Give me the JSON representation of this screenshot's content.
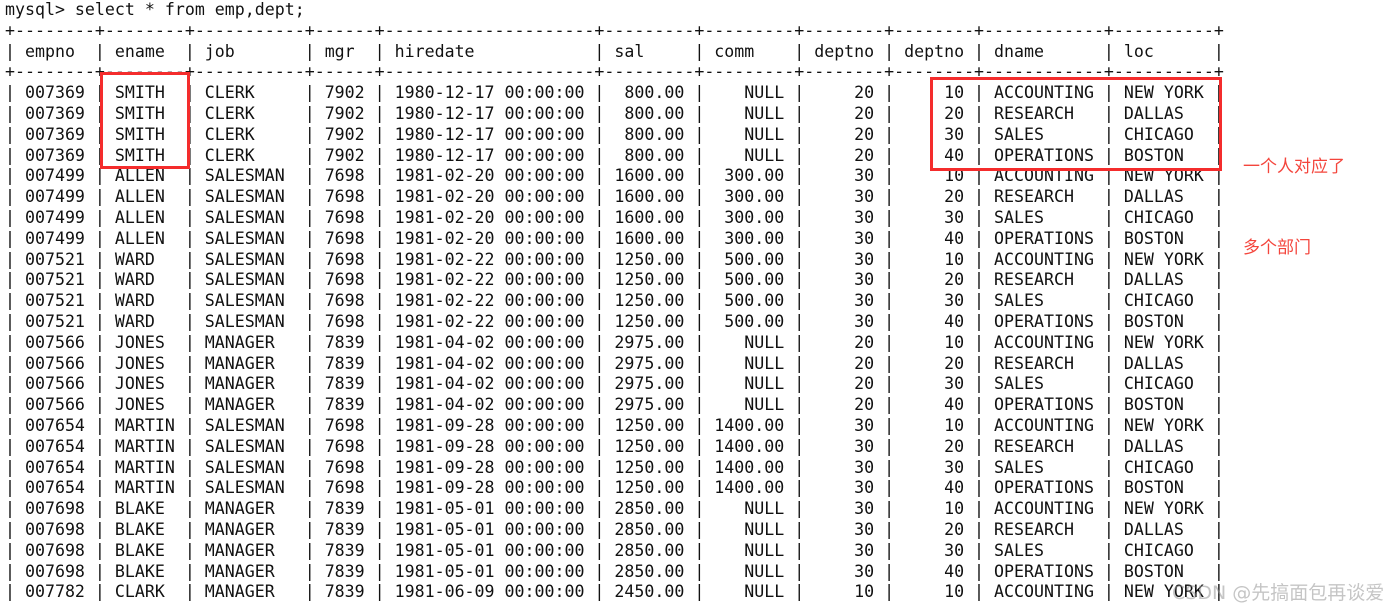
{
  "terminal": {
    "prompt_line": "mysql> select * from emp,dept;",
    "separator": "+--------+--------+-----------+------+---------------------+---------+---------+--------+--------+------------+----------+",
    "header_line": "| empno  | ename  | job       | mgr  | hiredate            | sal     | comm    | deptno | deptno | dname      | loc      |",
    "columns": [
      {
        "name": "empno",
        "width": 6
      },
      {
        "name": "ename",
        "width": 6
      },
      {
        "name": "job",
        "width": 9
      },
      {
        "name": "mgr",
        "width": 4
      },
      {
        "name": "hiredate",
        "width": 19
      },
      {
        "name": "sal",
        "width": 7
      },
      {
        "name": "comm",
        "width": 7
      },
      {
        "name": "deptno",
        "width": 6
      },
      {
        "name": "deptno",
        "width": 6
      },
      {
        "name": "dname",
        "width": 10
      },
      {
        "name": "loc",
        "width": 8
      }
    ],
    "rows": [
      [
        "007369",
        "SMITH",
        "CLERK",
        "7902",
        "1980-12-17 00:00:00",
        "800.00",
        "NULL",
        "20",
        "10",
        "ACCOUNTING",
        "NEW YORK"
      ],
      [
        "007369",
        "SMITH",
        "CLERK",
        "7902",
        "1980-12-17 00:00:00",
        "800.00",
        "NULL",
        "20",
        "20",
        "RESEARCH",
        "DALLAS"
      ],
      [
        "007369",
        "SMITH",
        "CLERK",
        "7902",
        "1980-12-17 00:00:00",
        "800.00",
        "NULL",
        "20",
        "30",
        "SALES",
        "CHICAGO"
      ],
      [
        "007369",
        "SMITH",
        "CLERK",
        "7902",
        "1980-12-17 00:00:00",
        "800.00",
        "NULL",
        "20",
        "40",
        "OPERATIONS",
        "BOSTON"
      ],
      [
        "007499",
        "ALLEN",
        "SALESMAN",
        "7698",
        "1981-02-20 00:00:00",
        "1600.00",
        "300.00",
        "30",
        "10",
        "ACCOUNTING",
        "NEW YORK"
      ],
      [
        "007499",
        "ALLEN",
        "SALESMAN",
        "7698",
        "1981-02-20 00:00:00",
        "1600.00",
        "300.00",
        "30",
        "20",
        "RESEARCH",
        "DALLAS"
      ],
      [
        "007499",
        "ALLEN",
        "SALESMAN",
        "7698",
        "1981-02-20 00:00:00",
        "1600.00",
        "300.00",
        "30",
        "30",
        "SALES",
        "CHICAGO"
      ],
      [
        "007499",
        "ALLEN",
        "SALESMAN",
        "7698",
        "1981-02-20 00:00:00",
        "1600.00",
        "300.00",
        "30",
        "40",
        "OPERATIONS",
        "BOSTON"
      ],
      [
        "007521",
        "WARD",
        "SALESMAN",
        "7698",
        "1981-02-22 00:00:00",
        "1250.00",
        "500.00",
        "30",
        "10",
        "ACCOUNTING",
        "NEW YORK"
      ],
      [
        "007521",
        "WARD",
        "SALESMAN",
        "7698",
        "1981-02-22 00:00:00",
        "1250.00",
        "500.00",
        "30",
        "20",
        "RESEARCH",
        "DALLAS"
      ],
      [
        "007521",
        "WARD",
        "SALESMAN",
        "7698",
        "1981-02-22 00:00:00",
        "1250.00",
        "500.00",
        "30",
        "30",
        "SALES",
        "CHICAGO"
      ],
      [
        "007521",
        "WARD",
        "SALESMAN",
        "7698",
        "1981-02-22 00:00:00",
        "1250.00",
        "500.00",
        "30",
        "40",
        "OPERATIONS",
        "BOSTON"
      ],
      [
        "007566",
        "JONES",
        "MANAGER",
        "7839",
        "1981-04-02 00:00:00",
        "2975.00",
        "NULL",
        "20",
        "10",
        "ACCOUNTING",
        "NEW YORK"
      ],
      [
        "007566",
        "JONES",
        "MANAGER",
        "7839",
        "1981-04-02 00:00:00",
        "2975.00",
        "NULL",
        "20",
        "20",
        "RESEARCH",
        "DALLAS"
      ],
      [
        "007566",
        "JONES",
        "MANAGER",
        "7839",
        "1981-04-02 00:00:00",
        "2975.00",
        "NULL",
        "20",
        "30",
        "SALES",
        "CHICAGO"
      ],
      [
        "007566",
        "JONES",
        "MANAGER",
        "7839",
        "1981-04-02 00:00:00",
        "2975.00",
        "NULL",
        "20",
        "40",
        "OPERATIONS",
        "BOSTON"
      ],
      [
        "007654",
        "MARTIN",
        "SALESMAN",
        "7698",
        "1981-09-28 00:00:00",
        "1250.00",
        "1400.00",
        "30",
        "10",
        "ACCOUNTING",
        "NEW YORK"
      ],
      [
        "007654",
        "MARTIN",
        "SALESMAN",
        "7698",
        "1981-09-28 00:00:00",
        "1250.00",
        "1400.00",
        "30",
        "20",
        "RESEARCH",
        "DALLAS"
      ],
      [
        "007654",
        "MARTIN",
        "SALESMAN",
        "7698",
        "1981-09-28 00:00:00",
        "1250.00",
        "1400.00",
        "30",
        "30",
        "SALES",
        "CHICAGO"
      ],
      [
        "007654",
        "MARTIN",
        "SALESMAN",
        "7698",
        "1981-09-28 00:00:00",
        "1250.00",
        "1400.00",
        "30",
        "40",
        "OPERATIONS",
        "BOSTON"
      ],
      [
        "007698",
        "BLAKE",
        "MANAGER",
        "7839",
        "1981-05-01 00:00:00",
        "2850.00",
        "NULL",
        "30",
        "10",
        "ACCOUNTING",
        "NEW YORK"
      ],
      [
        "007698",
        "BLAKE",
        "MANAGER",
        "7839",
        "1981-05-01 00:00:00",
        "2850.00",
        "NULL",
        "30",
        "20",
        "RESEARCH",
        "DALLAS"
      ],
      [
        "007698",
        "BLAKE",
        "MANAGER",
        "7839",
        "1981-05-01 00:00:00",
        "2850.00",
        "NULL",
        "30",
        "30",
        "SALES",
        "CHICAGO"
      ],
      [
        "007698",
        "BLAKE",
        "MANAGER",
        "7839",
        "1981-05-01 00:00:00",
        "2850.00",
        "NULL",
        "30",
        "40",
        "OPERATIONS",
        "BOSTON"
      ],
      [
        "007782",
        "CLARK",
        "MANAGER",
        "7839",
        "1981-06-09 00:00:00",
        "2450.00",
        "NULL",
        "10",
        "10",
        "ACCOUNTING",
        "NEW YORK"
      ]
    ]
  },
  "annotations": {
    "note_line1": "一个人对应了",
    "note_line2": "多个部门",
    "note_color": "#f4453c",
    "box_color": "#f42c2c"
  },
  "watermark": {
    "text": "CSDN @先搞面包再谈爱"
  }
}
